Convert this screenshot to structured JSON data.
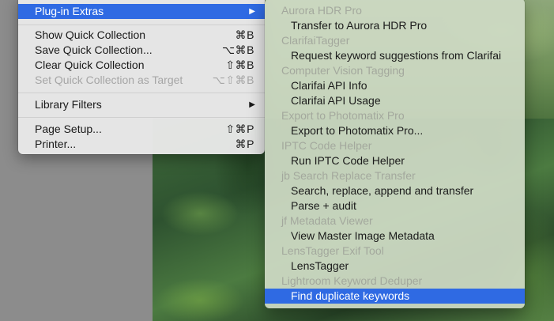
{
  "main_menu": {
    "items": [
      {
        "label": "Plug-in Extras",
        "shortcut": "",
        "submenu": true,
        "selected": true,
        "disabled": false
      },
      {
        "label": "Show Quick Collection",
        "shortcut": "⌘B",
        "disabled": false
      },
      {
        "label": "Save Quick Collection...",
        "shortcut": "⌥⌘B",
        "disabled": false
      },
      {
        "label": "Clear Quick Collection",
        "shortcut": "⇧⌘B",
        "disabled": false
      },
      {
        "label": "Set Quick Collection as Target",
        "shortcut": "⌥⇧⌘B",
        "disabled": true
      },
      {
        "label": "Library Filters",
        "shortcut": "",
        "submenu": true,
        "disabled": false
      },
      {
        "label": "Page Setup...",
        "shortcut": "⇧⌘P",
        "disabled": false
      },
      {
        "label": "Printer...",
        "shortcut": "⌘P",
        "disabled": false
      }
    ],
    "submenu_arrow": "▶"
  },
  "submenu": {
    "entries": [
      {
        "type": "header",
        "label": "Aurora HDR Pro"
      },
      {
        "type": "item",
        "label": "Transfer to Aurora HDR Pro"
      },
      {
        "type": "header",
        "label": "ClarifaiTagger"
      },
      {
        "type": "item",
        "label": "Request keyword suggestions from Clarifai"
      },
      {
        "type": "header",
        "label": "Computer Vision Tagging"
      },
      {
        "type": "item",
        "label": "Clarifai API Info"
      },
      {
        "type": "item",
        "label": "Clarifai API Usage"
      },
      {
        "type": "header",
        "label": "Export to Photomatix Pro"
      },
      {
        "type": "item",
        "label": "Export to Photomatix Pro..."
      },
      {
        "type": "header",
        "label": "IPTC Code Helper"
      },
      {
        "type": "item",
        "label": "Run IPTC Code Helper"
      },
      {
        "type": "header",
        "label": "jb Search Replace Transfer"
      },
      {
        "type": "item",
        "label": "Search, replace, append and transfer"
      },
      {
        "type": "item",
        "label": "Parse + audit"
      },
      {
        "type": "header",
        "label": "jf Metadata Viewer"
      },
      {
        "type": "item",
        "label": "View Master Image Metadata"
      },
      {
        "type": "header",
        "label": "LensTagger Exif Tool"
      },
      {
        "type": "item",
        "label": "LensTagger"
      },
      {
        "type": "header",
        "label": "Lightroom Keyword Deduper"
      },
      {
        "type": "item",
        "label": "Find duplicate keywords",
        "selected": true
      }
    ]
  },
  "colors": {
    "highlight": "#2f6ae3",
    "menu_bg": "#e8e8e8",
    "submenu_bg": "#cfdac5",
    "disabled_text": "#a6a6a6",
    "header_text": "#a3a89d"
  }
}
